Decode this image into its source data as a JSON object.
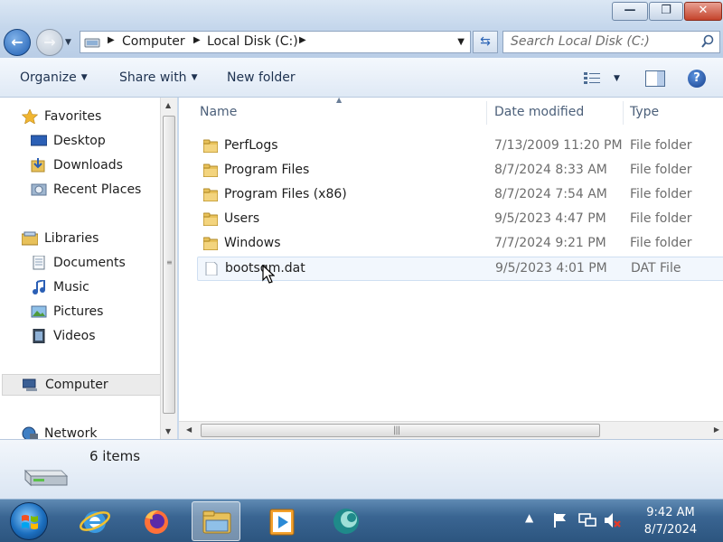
{
  "window": {
    "buttons": {
      "minimize": "—",
      "maximize": "❐",
      "close": "✕"
    }
  },
  "address": {
    "crumbs": [
      "Computer",
      "Local Disk (C:)"
    ],
    "search_placeholder": "Search Local Disk (C:)"
  },
  "toolbar": {
    "organize": "Organize",
    "share_with": "Share with",
    "new_folder": "New folder",
    "help": "?"
  },
  "nav": {
    "favorites": "Favorites",
    "desktop": "Desktop",
    "downloads": "Downloads",
    "recent_places": "Recent Places",
    "libraries": "Libraries",
    "documents": "Documents",
    "music": "Music",
    "pictures": "Pictures",
    "videos": "Videos",
    "computer": "Computer",
    "network": "Network"
  },
  "columns": {
    "name": "Name",
    "date_modified": "Date modified",
    "type": "Type"
  },
  "files": [
    {
      "name": "PerfLogs",
      "date": "7/13/2009 11:20 PM",
      "type": "File folder",
      "icon": "folder-icon"
    },
    {
      "name": "Program Files",
      "date": "8/7/2024 8:33 AM",
      "type": "File folder",
      "icon": "folder-icon"
    },
    {
      "name": "Program Files (x86)",
      "date": "8/7/2024 7:54 AM",
      "type": "File folder",
      "icon": "folder-icon"
    },
    {
      "name": "Users",
      "date": "9/5/2023 4:47 PM",
      "type": "File folder",
      "icon": "folder-icon"
    },
    {
      "name": "Windows",
      "date": "7/7/2024 9:21 PM",
      "type": "File folder",
      "icon": "folder-icon"
    },
    {
      "name": "bootsqm.dat",
      "date": "9/5/2023 4:01 PM",
      "type": "DAT File",
      "icon": "file-icon"
    }
  ],
  "details": {
    "count": "6 items"
  },
  "taskbar": {
    "time": "9:42 AM",
    "date": "8/7/2024"
  },
  "colors": {
    "accent": "#1f5fb4",
    "folder": "#e8c15a",
    "taskbar": "#3a6592"
  }
}
